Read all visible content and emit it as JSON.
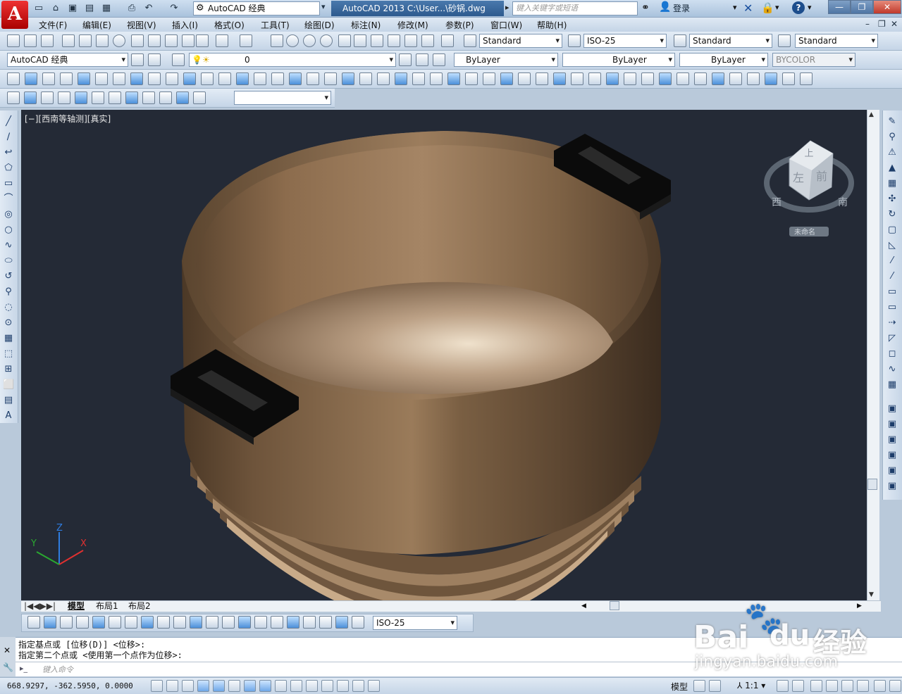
{
  "app": {
    "logo_letter": "A",
    "workspace": "AutoCAD 经典",
    "title": "AutoCAD 2013     C:\\User...\\砂锅.dwg",
    "search_placeholder": "键入关键字或短语",
    "login": "登录",
    "help": "?"
  },
  "menu": [
    "文件(F)",
    "编辑(E)",
    "视图(V)",
    "插入(I)",
    "格式(O)",
    "工具(T)",
    "绘图(D)",
    "标注(N)",
    "修改(M)",
    "参数(P)",
    "窗口(W)",
    "帮助(H)"
  ],
  "styles": {
    "text_style": "Standard",
    "dim_style": "ISO-25",
    "table_style": "Standard",
    "mleader_style": "Standard"
  },
  "layers": {
    "workspace": "AutoCAD 经典",
    "current_layer": "0",
    "color": "ByLayer",
    "linetype": "ByLayer",
    "lineweight": "ByLayer",
    "plotstyle": "BYCOLOR"
  },
  "viewport": {
    "label": "[−][西南等轴测][真实]",
    "bg": "#242a36",
    "viewcube": {
      "top": "上",
      "left": "左",
      "front": "前",
      "compass_w": "西",
      "compass_s": "南",
      "ucs": "未命名"
    },
    "ucs_x": "X",
    "ucs_y": "Y",
    "ucs_z": "Z"
  },
  "layout_tabs": [
    "模型",
    "布局1",
    "布局2"
  ],
  "dim_toolbar": {
    "dim_style": "ISO-25"
  },
  "command": {
    "line1": "指定基点或 [位移(D)] <位移>:",
    "line2": "指定第二个点或 <使用第一个点作为位移>:",
    "placeholder": "键入命令"
  },
  "status": {
    "coords": "668.9297, -362.5950, 0.0000",
    "model": "模型",
    "scale": "1:1"
  },
  "watermark": {
    "brand": "Bai",
    "brand2": "du",
    "sub": "经验",
    "url": "jingyan.baidu.com"
  },
  "colors": {
    "pot": "#8a6a4c",
    "handle": "#0a0a0a",
    "accent": "#2d5a8e"
  }
}
